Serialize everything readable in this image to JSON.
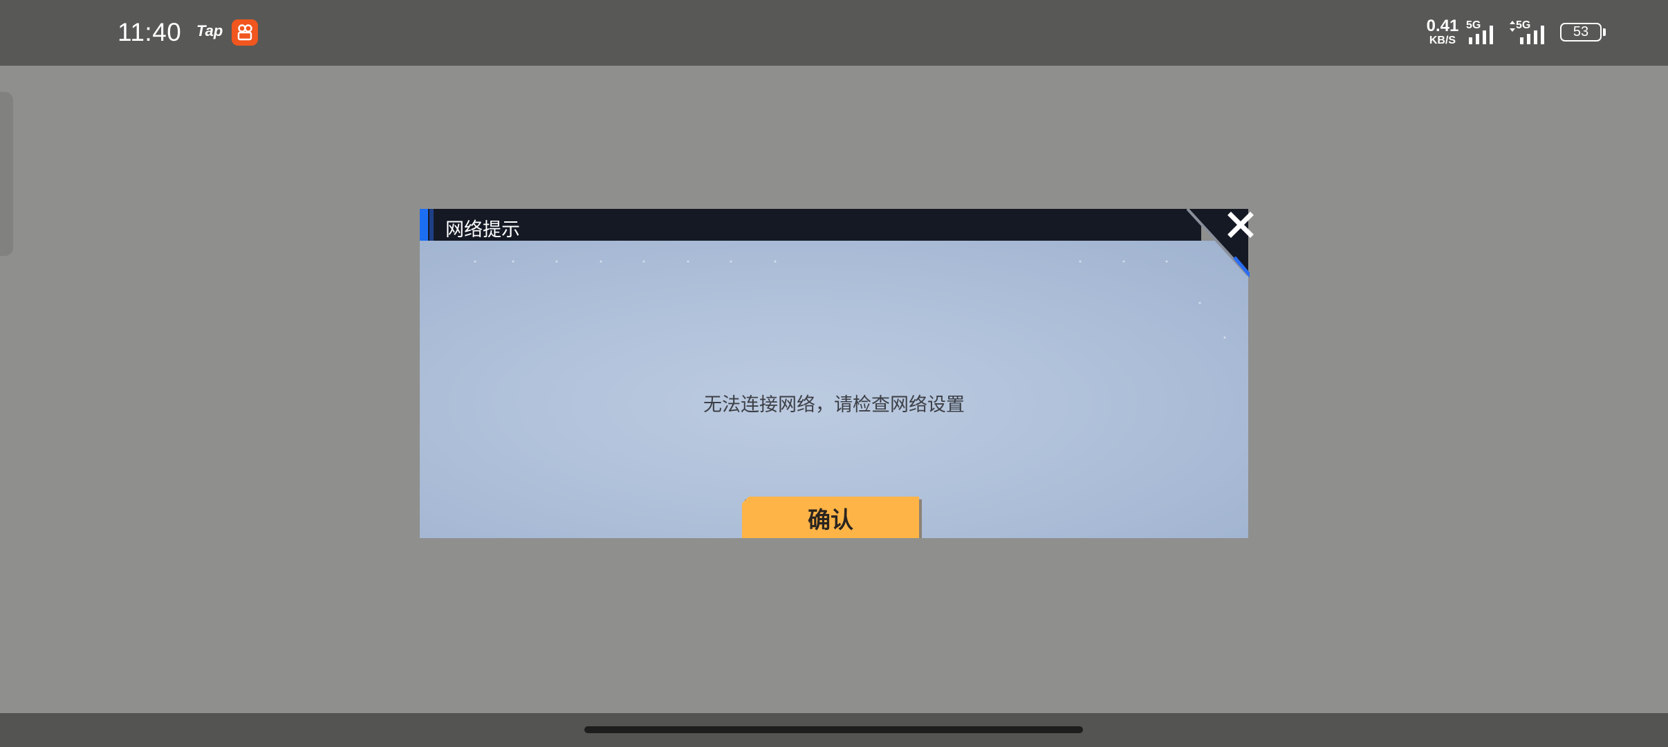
{
  "status_bar": {
    "time": "11:40",
    "tap_label": "Tap",
    "app_icon": "app-badge-icon",
    "network_speed": "0.41",
    "network_speed_unit": "KB/S",
    "sim1_label": "5G",
    "sim2_label": "5G",
    "battery_level": "53"
  },
  "dialog": {
    "title": "网络提示",
    "message": "无法连接网络，请检查网络设置",
    "confirm_label": "确认",
    "close_icon": "close-icon"
  },
  "colors": {
    "overlay": "#8f8f8d",
    "title_bar": "#151924",
    "accent_blue": "#1c6ef2",
    "confirm_button": "#ffb447",
    "dialog_body": "#b0c1da"
  }
}
